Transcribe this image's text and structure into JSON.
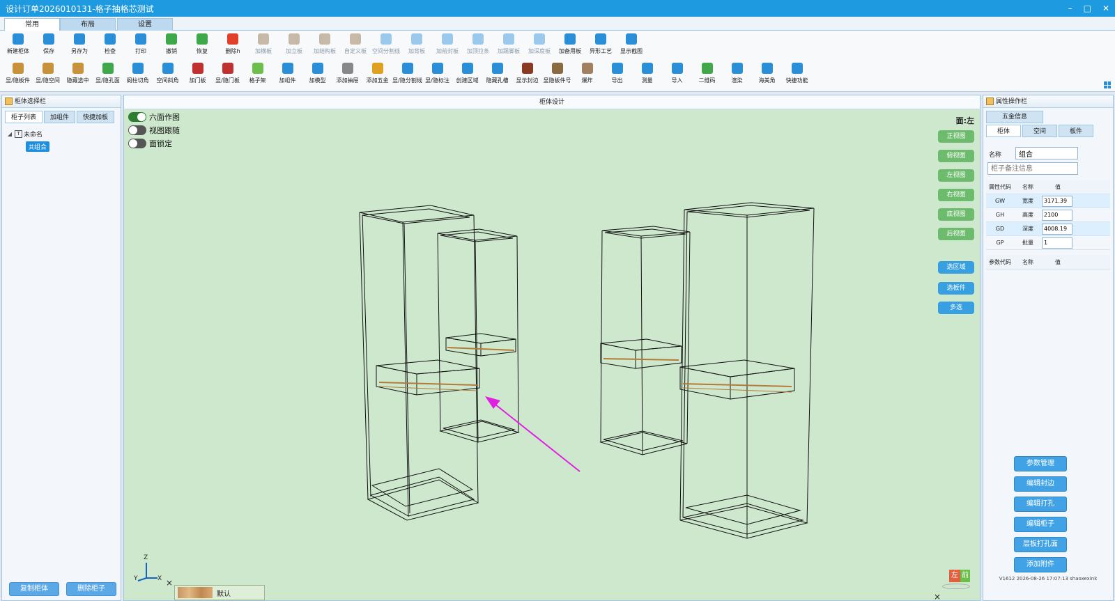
{
  "window": {
    "title": "设计订单2026010131-格子抽格芯测试",
    "controls": [
      "–",
      "□",
      "✕"
    ]
  },
  "ribbon_tabs": [
    "常用",
    "布局",
    "设置"
  ],
  "toolbar": {
    "row1": [
      {
        "label": "新建柜体",
        "icon": "new-cabinet-icon",
        "color": "#2b8fd8",
        "enabled": true
      },
      {
        "label": "保存",
        "icon": "save-icon",
        "color": "#2b8fd8",
        "enabled": true
      },
      {
        "label": "另存为",
        "icon": "save-as-icon",
        "color": "#2b8fd8",
        "enabled": true
      },
      {
        "label": "检查",
        "icon": "check-icon",
        "color": "#2b8fd8",
        "enabled": true
      },
      {
        "label": "打印",
        "icon": "print-icon",
        "color": "#2b8fd8",
        "enabled": true
      },
      {
        "label": "撤销",
        "icon": "undo-icon",
        "color": "#3ea84a",
        "enabled": true
      },
      {
        "label": "恢复",
        "icon": "redo-icon",
        "color": "#3ea84a",
        "enabled": true
      },
      {
        "label": "删除h",
        "icon": "delete-icon",
        "color": "#e0402a",
        "enabled": true
      },
      {
        "label": "加横板",
        "icon": "add-horizontal-board-icon",
        "color": "#8a6a40",
        "enabled": false
      },
      {
        "label": "加立板",
        "icon": "add-vertical-board-icon",
        "color": "#8a6a40",
        "enabled": false
      },
      {
        "label": "加结构板",
        "icon": "add-structure-board-icon",
        "color": "#8a6a40",
        "enabled": false
      },
      {
        "label": "自定义板",
        "icon": "custom-board-icon",
        "color": "#8a6a40",
        "enabled": false
      },
      {
        "label": "空间分割线",
        "icon": "space-divider-icon",
        "color": "#2b8fd8",
        "enabled": false
      },
      {
        "label": "加背板",
        "icon": "add-back-board-icon",
        "color": "#2b8fd8",
        "enabled": false
      },
      {
        "label": "加前封板",
        "icon": "add-front-panel-icon",
        "color": "#2b8fd8",
        "enabled": false
      },
      {
        "label": "加顶拉条",
        "icon": "add-top-strip-icon",
        "color": "#2b8fd8",
        "enabled": false
      },
      {
        "label": "加踢脚板",
        "icon": "add-kickboard-icon",
        "color": "#2b8fd8",
        "enabled": false
      },
      {
        "label": "加深度板",
        "icon": "add-depth-board-icon",
        "color": "#2b8fd8",
        "enabled": false
      },
      {
        "label": "加备用板",
        "icon": "add-spare-board-icon",
        "color": "#2b8fd8",
        "enabled": true
      },
      {
        "label": "异形工艺",
        "icon": "special-process-icon",
        "color": "#2b8fd8",
        "enabled": true
      },
      {
        "label": "显示截图",
        "icon": "screenshot-icon",
        "color": "#2b8fd8",
        "enabled": true
      }
    ],
    "row2": [
      {
        "label": "显/隐板件",
        "icon": "toggle-boards-icon",
        "color": "#c8923a",
        "enabled": true
      },
      {
        "label": "显/隐空间",
        "icon": "toggle-space-icon",
        "color": "#c8923a",
        "enabled": true
      },
      {
        "label": "隐藏选中",
        "icon": "hide-selected-icon",
        "color": "#c8923a",
        "enabled": true
      },
      {
        "label": "显/隐孔面",
        "icon": "toggle-holes-icon",
        "color": "#3ea84a",
        "enabled": true
      },
      {
        "label": "阁柱切角",
        "icon": "pillar-cut-icon",
        "color": "#2b8fd8",
        "enabled": true
      },
      {
        "label": "空间斜角",
        "icon": "space-bevel-icon",
        "color": "#2b8fd8",
        "enabled": true
      },
      {
        "label": "加门板",
        "icon": "add-door-icon",
        "color": "#c03030",
        "enabled": true
      },
      {
        "label": "显/隐门板",
        "icon": "toggle-doors-icon",
        "color": "#c03030",
        "enabled": true
      },
      {
        "label": "格子架",
        "icon": "grid-shelf-icon",
        "color": "#6cbf4a",
        "enabled": true
      },
      {
        "label": "加组件",
        "icon": "add-component-icon",
        "color": "#2b8fd8",
        "enabled": true
      },
      {
        "label": "加模型",
        "icon": "add-model-icon",
        "color": "#2b8fd8",
        "enabled": true
      },
      {
        "label": "添加抽屉",
        "icon": "add-drawer-icon",
        "color": "#888888",
        "enabled": true
      },
      {
        "label": "添加五金",
        "icon": "add-hardware-icon",
        "color": "#e0a020",
        "enabled": true
      },
      {
        "label": "显/隐分割线",
        "icon": "toggle-divider-icon",
        "color": "#2b8fd8",
        "enabled": true
      },
      {
        "label": "显/隐标注",
        "icon": "toggle-dimension-icon",
        "color": "#2b8fd8",
        "enabled": true
      },
      {
        "label": "创建区域",
        "icon": "create-region-icon",
        "color": "#2b8fd8",
        "enabled": true
      },
      {
        "label": "隐藏孔槽",
        "icon": "hide-holes-icon",
        "color": "#2b8fd8",
        "enabled": true
      },
      {
        "label": "显示封边",
        "icon": "show-edge-icon",
        "color": "#8a3a20",
        "enabled": true
      },
      {
        "label": "显隐板件号",
        "icon": "board-number-icon",
        "color": "#8a6a40",
        "enabled": true
      },
      {
        "label": "爆炸",
        "icon": "explode-icon",
        "color": "#a08060",
        "enabled": true
      },
      {
        "label": "导出",
        "icon": "export-icon",
        "color": "#2b8fd8",
        "enabled": true
      },
      {
        "label": "测量",
        "icon": "measure-icon",
        "color": "#2b8fd8",
        "enabled": true
      },
      {
        "label": "导入",
        "icon": "import-icon",
        "color": "#2b8fd8",
        "enabled": true
      },
      {
        "label": "二维码",
        "icon": "qrcode-icon",
        "color": "#3ea84a",
        "enabled": true
      },
      {
        "label": "渲染",
        "icon": "render-icon",
        "color": "#2b8fd8",
        "enabled": true
      },
      {
        "label": "海美角",
        "icon": "corner-icon",
        "color": "#2b8fd8",
        "enabled": true
      },
      {
        "label": "快捷功能",
        "icon": "shortcut-icon",
        "color": "#2b8fd8",
        "enabled": true
      }
    ]
  },
  "left_panel": {
    "title": "柜体选择栏",
    "tabs": [
      "柜子列表",
      "加组件",
      "快捷加板"
    ],
    "tree": {
      "root_label": "未命名",
      "child_badge": "其",
      "child_label": "组合"
    },
    "copy_button": "复制柜体",
    "delete_button": "删除柜子"
  },
  "viewport": {
    "title": "柜体设计",
    "face_label": "面:左",
    "toggles": [
      {
        "label": "六面作图",
        "on": true
      },
      {
        "label": "视图跟随",
        "on": false
      },
      {
        "label": "面锁定",
        "on": false
      }
    ],
    "view_buttons": [
      "正视图",
      "俯视图",
      "左视图",
      "右视图",
      "底视图",
      "后视图"
    ],
    "select_buttons": [
      "选区域",
      "选板件",
      "多选"
    ],
    "axis": {
      "z": "Z",
      "y": "Y",
      "x": "X"
    },
    "material_label": "默认",
    "close_glyph": "×",
    "cube_labels": {
      "left": "左",
      "front": "前"
    }
  },
  "right_panel": {
    "title": "属性操作栏",
    "hardware_tab": "五金信息",
    "tabs": [
      "柜体",
      "空间",
      "板件"
    ],
    "name_label": "名称",
    "name_value": "组合",
    "remark_placeholder": "柜子备注信息",
    "props_header": [
      "属性代码",
      "名称",
      "值"
    ],
    "props": [
      {
        "code": "GW",
        "name": "宽度",
        "value": "3171.39"
      },
      {
        "code": "GH",
        "name": "高度",
        "value": "2100"
      },
      {
        "code": "GD",
        "name": "深度",
        "value": "4008.19"
      },
      {
        "code": "GP",
        "name": "批量",
        "value": "1"
      }
    ],
    "params_header": [
      "参数代码",
      "名称",
      "值"
    ],
    "actions": [
      "参数管理",
      "编辑封边",
      "编辑打孔",
      "编辑柜子",
      "层板打孔面",
      "添加附件"
    ],
    "version": "V1612 2026-08-26 17:07:13 shaoxexink"
  }
}
